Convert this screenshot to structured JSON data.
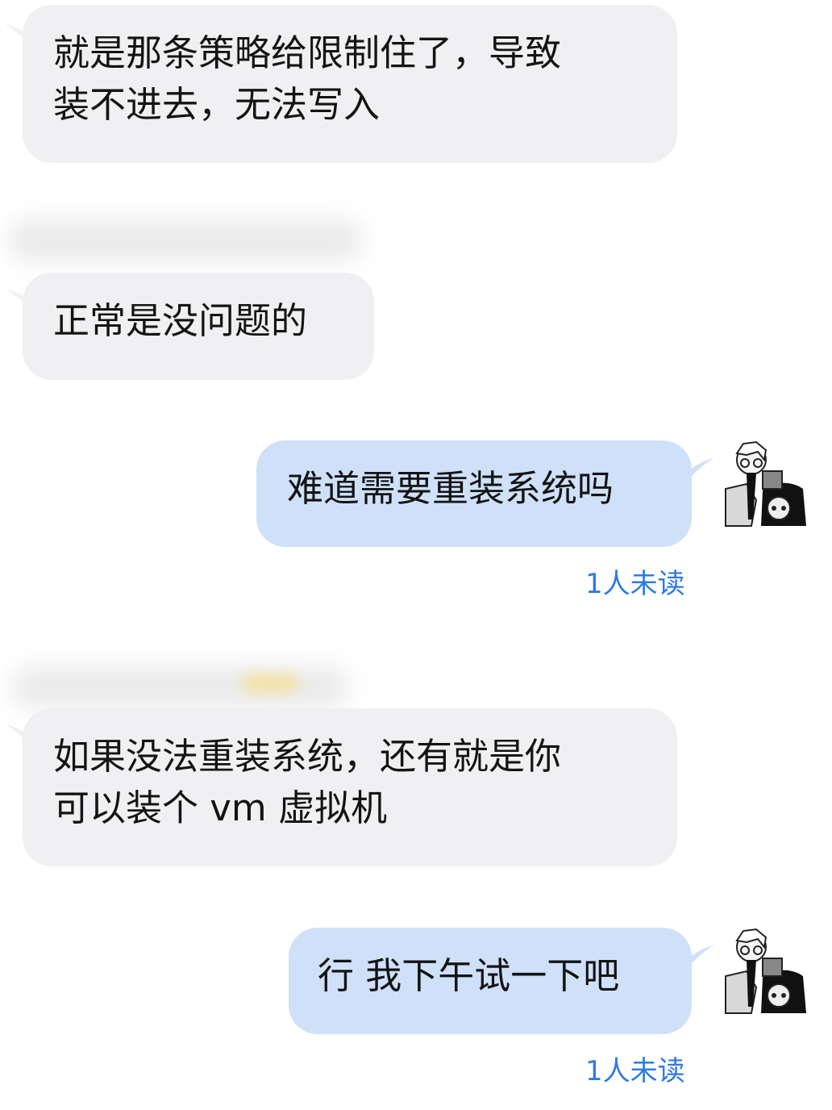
{
  "messages": [
    {
      "text": "就是那条策略给限制住了，导致\n装不进去，无法写入"
    },
    {
      "text": "正常是没问题的"
    },
    {
      "text": "难道需要重装系统吗"
    },
    {
      "text": "如果没法重装系统，还有就是你\n可以装个 vm 虚拟机"
    },
    {
      "text": "行 我下午试一下吧"
    }
  ],
  "status": {
    "read1": "1人未读",
    "read2": "1人未读"
  },
  "colors": {
    "incoming_bubble": "#f0f0f2",
    "outgoing_bubble": "#cfe1f9",
    "read_status": "#2f7be0"
  },
  "icons": [
    "user-avatar-cartoon-icon",
    "user-avatar-cartoon-icon"
  ]
}
